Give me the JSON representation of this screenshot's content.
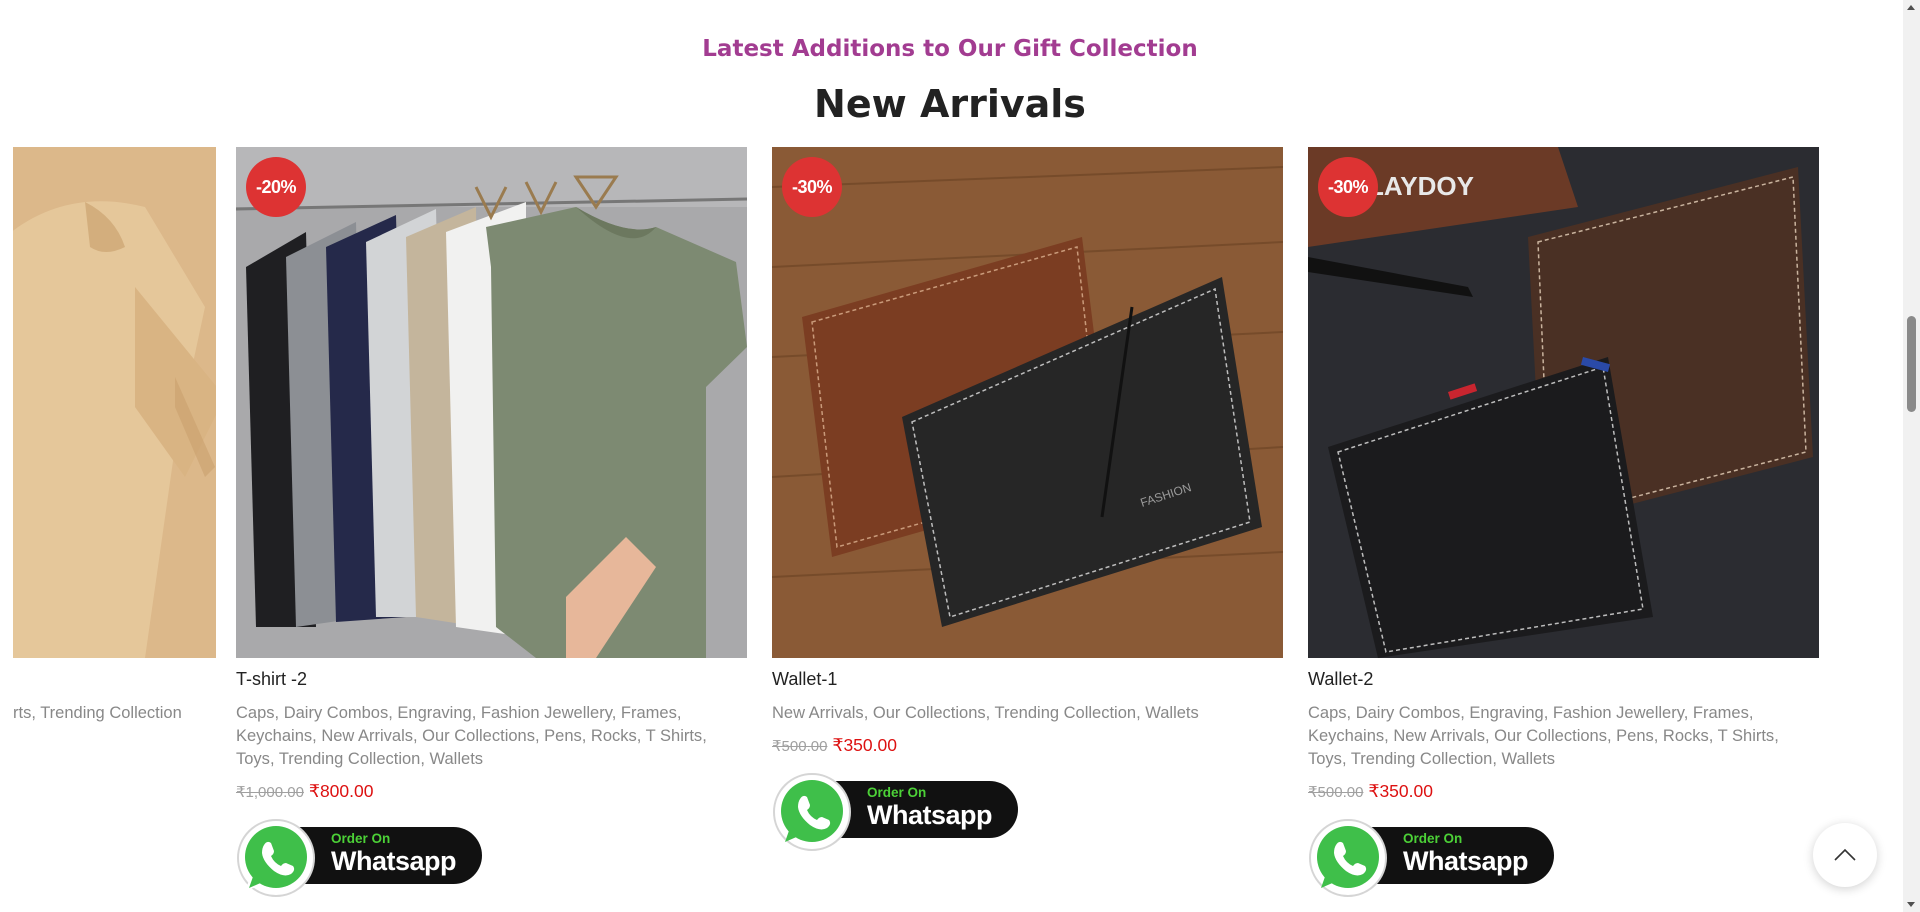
{
  "section": {
    "subtitle": "Latest Additions to Our Gift Collection",
    "title": "New Arrivals"
  },
  "partial_card": {
    "categories_tail": "rts",
    "category_last": "Trending Collection"
  },
  "products": [
    {
      "name": "T-shirt -2",
      "badge": "-20%",
      "categories": [
        "Caps",
        "Dairy Combos",
        "Engraving",
        "Fashion Jewellery",
        "Frames",
        "Keychains",
        "New Arrivals",
        "Our Collections",
        "Pens",
        "Rocks",
        "T Shirts",
        "Toys",
        "Trending Collection",
        "Wallets"
      ],
      "old_price": "₹1,000.00",
      "new_price": "₹800.00"
    },
    {
      "name": "Wallet-1",
      "badge": "-30%",
      "categories": [
        "New Arrivals",
        "Our Collections",
        "Trending Collection",
        "Wallets"
      ],
      "old_price": "₹500.00",
      "new_price": "₹350.00"
    },
    {
      "name": "Wallet-2",
      "badge": "-30%",
      "categories": [
        "Caps",
        "Dairy Combos",
        "Engraving",
        "Fashion Jewellery",
        "Frames",
        "Keychains",
        "New Arrivals",
        "Our Collections",
        "Pens",
        "Rocks",
        "T Shirts",
        "Toys",
        "Trending Collection",
        "Wallets"
      ],
      "old_price": "₹500.00",
      "new_price": "₹350.00"
    }
  ],
  "whatsapp_button": {
    "small": "Order On",
    "big": "Whatsapp"
  },
  "wallet2_image_brand": "LAYDOY",
  "icons": {
    "whatsapp": "whatsapp-icon",
    "scroll_top": "chevron-up-icon"
  },
  "colors": {
    "subtitle": "#a23c91",
    "sale_badge": "#dd3333",
    "sale_price": "#dd1111",
    "whatsapp_green": "#4cd137"
  }
}
